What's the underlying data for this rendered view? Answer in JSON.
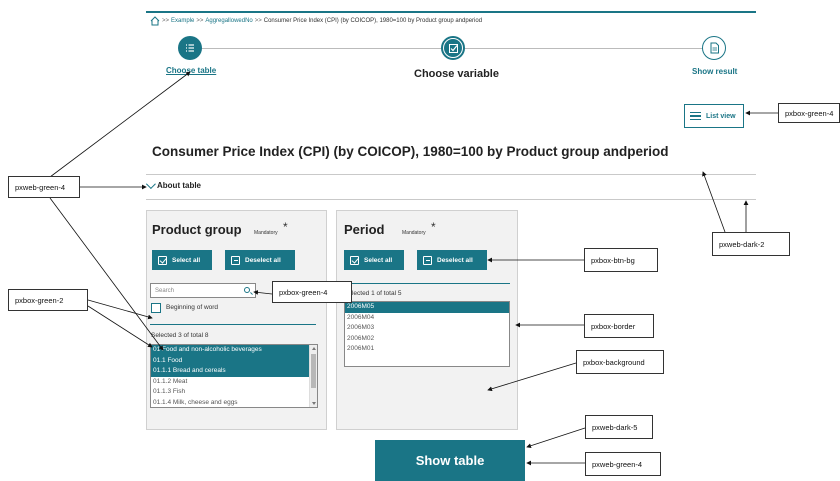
{
  "breadcrumb": {
    "items": [
      "Example",
      "AggregallowedNo",
      "Consumer Price Index (CPI) (by COICOP), 1980=100 by Product group andperiod"
    ],
    "separator": ">>"
  },
  "wizard": {
    "steps": [
      {
        "label": "Choose table",
        "icon": "list-icon"
      },
      {
        "label": "Choose variable",
        "icon": "checkbox-icon"
      },
      {
        "label": "Show result",
        "icon": "document-icon"
      }
    ]
  },
  "list_view_label": "List view",
  "page_title": "Consumer Price Index (CPI) (by COICOP), 1980=100 by Product group andperiod",
  "about_table": "About table",
  "product_group": {
    "title": "Product group",
    "mandatory": "Mandatory",
    "required_mark": "*",
    "select_all": "Select all",
    "deselect_all": "Deselect all",
    "search_placeholder": "Search",
    "beginning_of_word": "Beginning of word",
    "selected_info": "Selected 3 of total 8",
    "items": [
      {
        "label": "01 Food and non-alcoholic beverages",
        "selected": true
      },
      {
        "label": "01.1 Food",
        "selected": true
      },
      {
        "label": "01.1.1 Bread and cereals",
        "selected": true
      },
      {
        "label": "01.1.2 Meat",
        "selected": false
      },
      {
        "label": "01.1.3 Fish",
        "selected": false
      },
      {
        "label": "01.1.4 Milk, cheese and eggs",
        "selected": false
      }
    ]
  },
  "period": {
    "title": "Period",
    "mandatory": "Mandatory",
    "required_mark": "*",
    "select_all": "Select all",
    "deselect_all": "Deselect all",
    "selected_info": "Selected 1 of total 5",
    "items": [
      {
        "label": "2006M05",
        "selected": true
      },
      {
        "label": "2006M04",
        "selected": false
      },
      {
        "label": "2006M03",
        "selected": false
      },
      {
        "label": "2006M02",
        "selected": false
      },
      {
        "label": "2006M01",
        "selected": false
      }
    ]
  },
  "show_table": "Show table",
  "annotations": {
    "green4_left": "pxweb-green-4",
    "green4_list": "pxbox-green-4",
    "dark2": "pxweb-dark-2",
    "green2": "pxbox-green-2",
    "green4_search": "pxbox-green-4",
    "btn_bg": "pxbox-btn-bg",
    "border": "pxbox-border",
    "background": "pxbox-background",
    "dark5": "pxweb-dark-5",
    "green4_show": "pxweb-green-4"
  },
  "colors": {
    "green4": "#1a7586",
    "box_bg": "#f2f2f2",
    "box_border": "#d0d0d0"
  }
}
